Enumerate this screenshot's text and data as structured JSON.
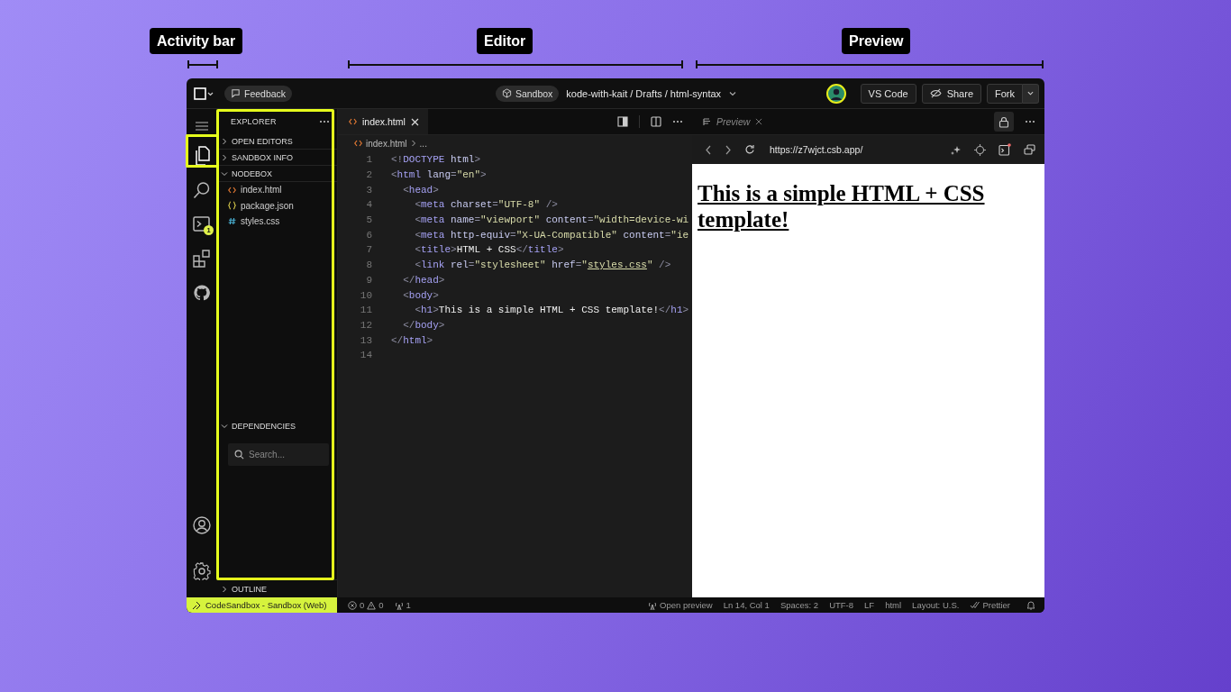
{
  "annotations": [
    {
      "label": "Activity bar",
      "kind": "activity"
    },
    {
      "label": "Editor",
      "kind": "editor"
    },
    {
      "label": "Preview",
      "kind": "preview"
    }
  ],
  "top_bar": {
    "feedback": "Feedback",
    "sandbox_badge": "Sandbox",
    "breadcrumb": "kode-with-kait / Drafts / html-syntax",
    "buttons": [
      {
        "label": "VS Code",
        "kind": "plain"
      },
      {
        "label": "Share",
        "kind": "share"
      },
      {
        "label": "Fork",
        "kind": "split"
      }
    ]
  },
  "activity_bar": {
    "items": [
      {
        "kind": "menu",
        "selected": false
      },
      {
        "kind": "files",
        "selected": true
      },
      {
        "kind": "search",
        "selected": false
      },
      {
        "kind": "terminal",
        "selected": false,
        "badge": "1"
      },
      {
        "kind": "extensions",
        "selected": false
      },
      {
        "kind": "github",
        "selected": false
      }
    ],
    "bottom": [
      {
        "kind": "account"
      },
      {
        "kind": "settings"
      }
    ]
  },
  "sidebar": {
    "title": "EXPLORER",
    "sections": [
      {
        "label": "OPEN EDITORS",
        "expanded": false
      },
      {
        "label": "SANDBOX INFO",
        "expanded": false
      },
      {
        "label": "NODEBOX",
        "expanded": true,
        "children": [
          {
            "name": "index.html",
            "kind": "html"
          },
          {
            "name": "package.json",
            "kind": "json"
          },
          {
            "name": "styles.css",
            "kind": "css"
          }
        ]
      }
    ],
    "dependencies": {
      "label": "DEPENDENCIES",
      "expanded": true,
      "placeholder": "Search..."
    },
    "outline": {
      "label": "OUTLINE",
      "expanded": false
    }
  },
  "editor": {
    "tabs": [
      {
        "label": "index.html",
        "selected": true
      }
    ],
    "breadcrumb": "index.html",
    "breadcrumb_more": "...",
    "lines": [
      {
        "number": "1",
        "tokens": [
          {
            "kind": "p",
            "text": "<!"
          },
          {
            "kind": "tag",
            "text": "DOCTYPE"
          },
          {
            "kind": "attr",
            "text": " html"
          },
          {
            "kind": "p",
            "text": ">"
          }
        ]
      },
      {
        "number": "2",
        "tokens": [
          {
            "kind": "p",
            "text": "<"
          },
          {
            "kind": "tag",
            "text": "html"
          },
          {
            "kind": "attr",
            "text": " lang"
          },
          {
            "kind": "p",
            "text": "="
          },
          {
            "kind": "str",
            "text": "\"en\""
          },
          {
            "kind": "p",
            "text": ">"
          }
        ]
      },
      {
        "number": "3",
        "tokens": [
          {
            "kind": "p",
            "text": "  <"
          },
          {
            "kind": "tag",
            "text": "head"
          },
          {
            "kind": "p",
            "text": ">"
          }
        ]
      },
      {
        "number": "4",
        "tokens": [
          {
            "kind": "p",
            "text": "    <"
          },
          {
            "kind": "tag",
            "text": "meta"
          },
          {
            "kind": "attr",
            "text": " charset"
          },
          {
            "kind": "p",
            "text": "="
          },
          {
            "kind": "str",
            "text": "\"UTF-8\""
          },
          {
            "kind": "p",
            "text": " />"
          }
        ]
      },
      {
        "number": "5",
        "tokens": [
          {
            "kind": "p",
            "text": "    <"
          },
          {
            "kind": "tag",
            "text": "meta"
          },
          {
            "kind": "attr",
            "text": " name"
          },
          {
            "kind": "p",
            "text": "="
          },
          {
            "kind": "str",
            "text": "\"viewport\""
          },
          {
            "kind": "attr",
            "text": " content"
          },
          {
            "kind": "p",
            "text": "="
          },
          {
            "kind": "str",
            "text": "\"width=device-wi"
          }
        ]
      },
      {
        "number": "6",
        "tokens": [
          {
            "kind": "p",
            "text": "    <"
          },
          {
            "kind": "tag",
            "text": "meta"
          },
          {
            "kind": "attr",
            "text": " http-equiv"
          },
          {
            "kind": "p",
            "text": "="
          },
          {
            "kind": "str",
            "text": "\"X-UA-Compatible\""
          },
          {
            "kind": "attr",
            "text": " content"
          },
          {
            "kind": "p",
            "text": "="
          },
          {
            "kind": "str",
            "text": "\"ie"
          }
        ]
      },
      {
        "number": "7",
        "tokens": [
          {
            "kind": "p",
            "text": "    <"
          },
          {
            "kind": "tag",
            "text": "title"
          },
          {
            "kind": "p",
            "text": ">"
          },
          {
            "kind": "text",
            "text": "HTML + CSS"
          },
          {
            "kind": "p",
            "text": "</"
          },
          {
            "kind": "tag",
            "text": "title"
          },
          {
            "kind": "p",
            "text": ">"
          }
        ]
      },
      {
        "number": "8",
        "tokens": [
          {
            "kind": "p",
            "text": "    <"
          },
          {
            "kind": "tag",
            "text": "link"
          },
          {
            "kind": "attr",
            "text": " rel"
          },
          {
            "kind": "p",
            "text": "="
          },
          {
            "kind": "str",
            "text": "\"stylesheet\""
          },
          {
            "kind": "attr",
            "text": " href"
          },
          {
            "kind": "p",
            "text": "="
          },
          {
            "kind": "str",
            "text": "\""
          },
          {
            "kind": "link",
            "text": "styles.css"
          },
          {
            "kind": "str",
            "text": "\""
          },
          {
            "kind": "p",
            "text": " />"
          }
        ]
      },
      {
        "number": "9",
        "tokens": [
          {
            "kind": "p",
            "text": "  </"
          },
          {
            "kind": "tag",
            "text": "head"
          },
          {
            "kind": "p",
            "text": ">"
          }
        ]
      },
      {
        "number": "10",
        "tokens": [
          {
            "kind": "p",
            "text": "  <"
          },
          {
            "kind": "tag",
            "text": "body"
          },
          {
            "kind": "p",
            "text": ">"
          }
        ]
      },
      {
        "number": "11",
        "tokens": [
          {
            "kind": "p",
            "text": "    <"
          },
          {
            "kind": "tag",
            "text": "h1"
          },
          {
            "kind": "p",
            "text": ">"
          },
          {
            "kind": "text",
            "text": "This is a simple HTML + CSS template!"
          },
          {
            "kind": "p",
            "text": "</"
          },
          {
            "kind": "tag",
            "text": "h1"
          },
          {
            "kind": "p",
            "text": ">"
          }
        ]
      },
      {
        "number": "12",
        "tokens": [
          {
            "kind": "p",
            "text": "  </"
          },
          {
            "kind": "tag",
            "text": "body"
          },
          {
            "kind": "p",
            "text": ">"
          }
        ]
      },
      {
        "number": "13",
        "tokens": [
          {
            "kind": "p",
            "text": "</"
          },
          {
            "kind": "tag",
            "text": "html"
          },
          {
            "kind": "p",
            "text": ">"
          }
        ]
      },
      {
        "number": "14"
      }
    ]
  },
  "preview": {
    "tab": "Preview",
    "url": "https://z7wjct.csb.app/",
    "heading": "This is a simple HTML + CSS template!"
  },
  "status_bar": {
    "remote": "CodeSandbox - Sandbox (Web)",
    "errors": "0",
    "warnings": "0",
    "ports": "1",
    "items": [
      {
        "text": "Open preview",
        "kind": "broadcast"
      },
      {
        "text": "Ln 14, Col 1",
        "kind": "plain"
      },
      {
        "text": "Spaces: 2",
        "kind": "plain"
      },
      {
        "text": "UTF-8",
        "kind": "plain"
      },
      {
        "text": "LF",
        "kind": "plain"
      },
      {
        "text": "html",
        "kind": "plain"
      },
      {
        "text": "Layout: U.S.",
        "kind": "plain"
      },
      {
        "text": "Prettier",
        "kind": "check"
      }
    ]
  }
}
